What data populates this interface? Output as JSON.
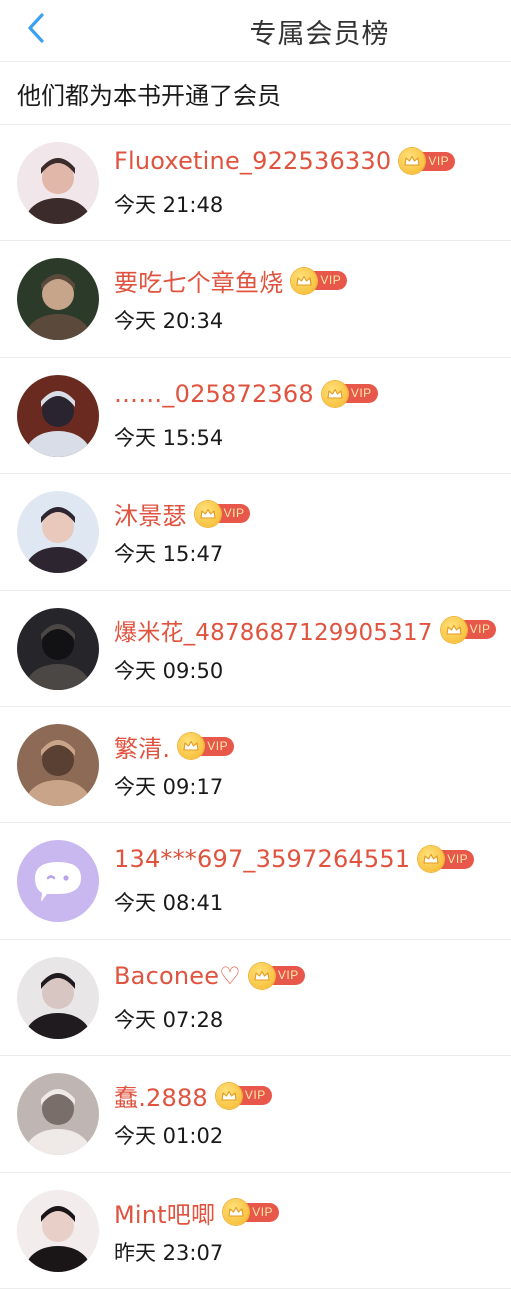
{
  "header": {
    "title": "专属会员榜"
  },
  "subtitle": "他们都为本书开通了会员",
  "vip_label": "VIP",
  "colors": {
    "name": "#e0533f",
    "vip_tag": "#e8584a",
    "crown": "#f5b62a",
    "back": "#3aa0f0"
  },
  "members": [
    {
      "name": "Fluoxetine_922536330",
      "time": "今天 21:48",
      "avatar": "avatar-photo"
    },
    {
      "name": "要吃七个章鱼烧",
      "time": "今天 20:34",
      "avatar": "avatar-photo"
    },
    {
      "name": "……_025872368",
      "time": "今天 15:54",
      "avatar": "avatar-photo"
    },
    {
      "name": "沐景瑟",
      "time": "今天 15:47",
      "avatar": "avatar-photo"
    },
    {
      "name": "爆米花_4878687129905317",
      "time": "今天 09:50",
      "avatar": "avatar-photo"
    },
    {
      "name": "繁清.",
      "time": "今天 09:17",
      "avatar": "avatar-photo"
    },
    {
      "name": "134***697_3597264551",
      "time": "今天 08:41",
      "avatar": "default-avatar-icon"
    },
    {
      "name": "Baconee♡",
      "time": "今天 07:28",
      "avatar": "avatar-photo"
    },
    {
      "name": "蠢.2888",
      "time": "今天 01:02",
      "avatar": "avatar-photo"
    },
    {
      "name": "Mint吧唧",
      "time": "昨天 23:07",
      "avatar": "avatar-photo"
    }
  ]
}
